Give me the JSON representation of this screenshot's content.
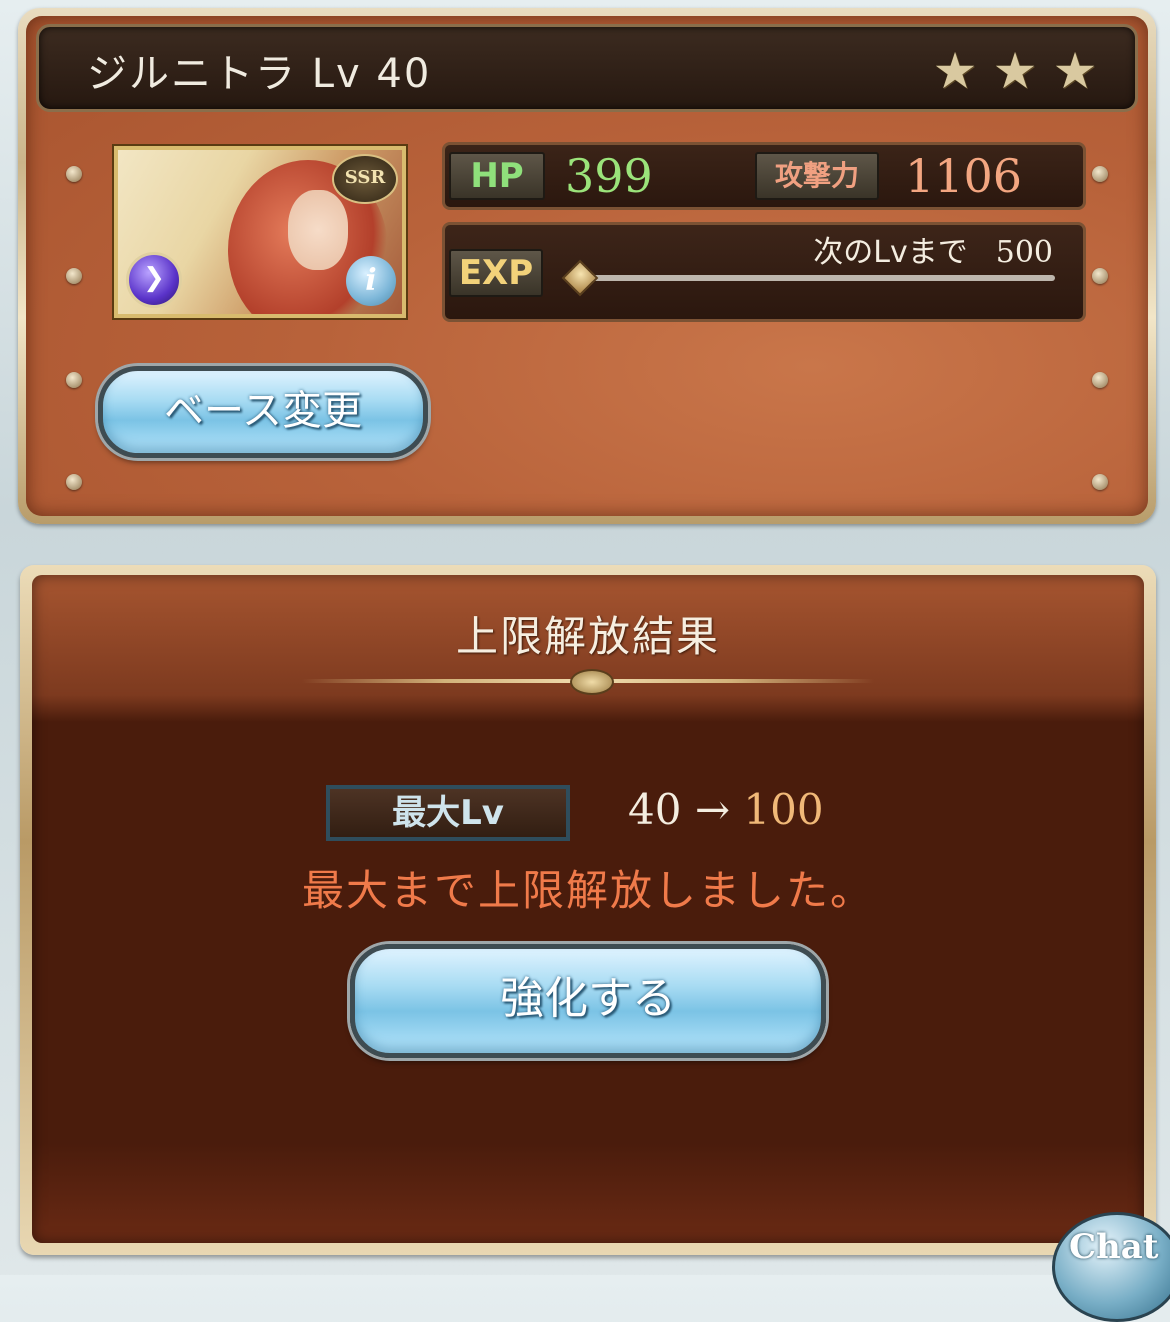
{
  "character": {
    "title": "ジルニトラ Lv 40",
    "rarity_badge": "SSR",
    "stars": [
      "★",
      "★",
      "★"
    ]
  },
  "stats": {
    "hp_label": "HP",
    "hp_value": "399",
    "atk_label": "攻撃力",
    "atk_value": "1106",
    "exp_label": "EXP",
    "next_level_label": "次のLvまで",
    "next_level_value": "500",
    "exp_progress": 0
  },
  "buttons": {
    "base_change": "ベース変更",
    "enhance": "強化する",
    "chat": "Chat"
  },
  "result": {
    "title": "上限解放結果",
    "max_lv_label": "最大Lv",
    "lv_from": "40",
    "arrow": "→",
    "lv_to": "100",
    "message": "最大まで上限解放しました。"
  },
  "colors": {
    "hp_green": "#9be37a",
    "atk_orange": "#f3a681",
    "message_red": "#f07a4a",
    "lv_to_gold": "#f0b878"
  },
  "icons": {
    "element": "wind-element-icon",
    "info": "info-icon"
  }
}
